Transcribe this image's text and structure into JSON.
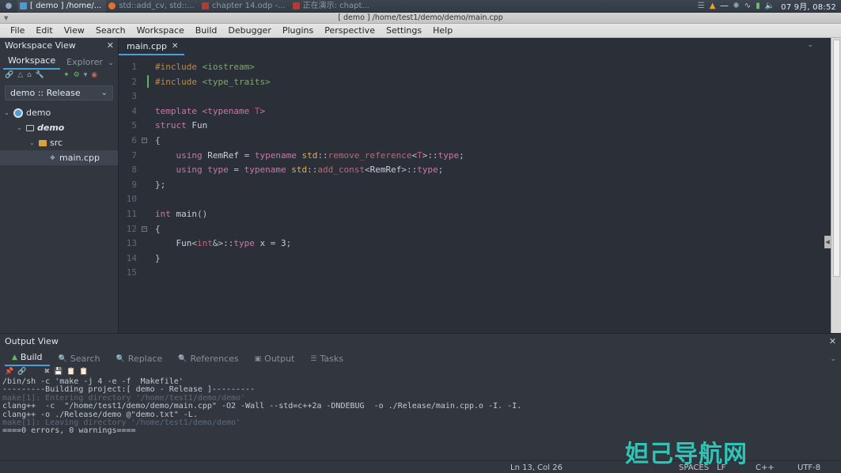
{
  "taskbar": {
    "start_icon": "menu-icon",
    "tasks": [
      {
        "label": "[ demo ] /home/...",
        "icon": "terminal-icon",
        "active": true
      },
      {
        "label": "std::add_cv, std::...",
        "icon": "firefox-icon",
        "active": false
      },
      {
        "label": "chapter 14.odp -...",
        "icon": "impress-icon",
        "active": false
      },
      {
        "label": "正在演示: chapt...",
        "icon": "impress-icon",
        "active": false
      }
    ],
    "tray_icons": [
      "network-icon",
      "warning-icon",
      "keyboard-icon",
      "bluetooth-icon",
      "wifi-icon",
      "battery-icon",
      "volume-icon"
    ],
    "clock": "07 9月, 08:52"
  },
  "titlebar": {
    "title": "[ demo ] /home/test1/demo/demo/main.cpp"
  },
  "menubar": {
    "items": [
      "File",
      "Edit",
      "View",
      "Search",
      "Workspace",
      "Build",
      "Debugger",
      "Plugins",
      "Perspective",
      "Settings",
      "Help"
    ]
  },
  "workspace_view": {
    "title": "Workspace View",
    "close_label": "✕",
    "tabs": [
      {
        "label": "Workspace",
        "active": true
      },
      {
        "label": "Explorer",
        "active": false
      }
    ],
    "overflow_chevron": "⌄",
    "toolbar_icons": [
      "link-icon",
      "send-icon",
      "home-icon",
      "wrench-icon",
      "run-icon",
      "build-icon",
      "chevron-down-icon",
      "stop-icon"
    ],
    "target_combo": {
      "value": "demo :: Release",
      "chevron": "⌄"
    },
    "tree": [
      {
        "label": "demo",
        "depth": 0,
        "icon": "project-icon",
        "twisty": "⌄",
        "selected": false,
        "emphasis": false
      },
      {
        "label": "demo",
        "depth": 1,
        "icon": "folder-icon",
        "twisty": "⌄",
        "selected": false,
        "emphasis": true
      },
      {
        "label": "src",
        "depth": 2,
        "icon": "folder-yellow-icon",
        "twisty": "⌄",
        "selected": false,
        "emphasis": false
      },
      {
        "label": "main.cpp",
        "depth": 3,
        "icon": "cpp-file-icon",
        "twisty": "",
        "selected": true,
        "emphasis": false
      }
    ]
  },
  "editor": {
    "tab": {
      "label": "main.cpp",
      "close": "✕"
    },
    "overflow_chevron": "⌄",
    "line_numbers": [
      "1",
      "2",
      "3",
      "4",
      "5",
      "6",
      "7",
      "8",
      "9",
      "10",
      "11",
      "12",
      "13",
      "14",
      "15"
    ],
    "lines": [
      {
        "n": 1,
        "tokens": [
          {
            "t": "#include ",
            "c": "k-pre"
          },
          {
            "t": "<iostream>",
            "c": "k-hdr"
          }
        ]
      },
      {
        "n": 2,
        "tokens": [
          {
            "t": "#include ",
            "c": "k-pre"
          },
          {
            "t": "<type_traits>",
            "c": "k-hdr"
          }
        ]
      },
      {
        "n": 3,
        "tokens": []
      },
      {
        "n": 4,
        "tokens": [
          {
            "t": "template ",
            "c": "k-kw"
          },
          {
            "t": "<typename ",
            "c": "k-kw"
          },
          {
            "t": "T",
            "c": "k-tmpl"
          },
          {
            "t": ">",
            "c": "k-kw"
          }
        ]
      },
      {
        "n": 5,
        "tokens": [
          {
            "t": "struct ",
            "c": "k-kw"
          },
          {
            "t": "Fun",
            "c": "k-id"
          }
        ]
      },
      {
        "n": 6,
        "tokens": [
          {
            "t": "{",
            "c": "k-punc"
          }
        ]
      },
      {
        "n": 7,
        "tokens": [
          {
            "t": "    using ",
            "c": "k-kw"
          },
          {
            "t": "RemRef ",
            "c": "k-id"
          },
          {
            "t": "= ",
            "c": "k-punc"
          },
          {
            "t": "typename ",
            "c": "k-kw"
          },
          {
            "t": "std",
            "c": "k-ns"
          },
          {
            "t": "::",
            "c": "k-punc"
          },
          {
            "t": "remove_reference",
            "c": "k-fn"
          },
          {
            "t": "<",
            "c": "k-punc"
          },
          {
            "t": "T",
            "c": "k-tmpl"
          },
          {
            "t": ">::",
            "c": "k-punc"
          },
          {
            "t": "type",
            "c": "k-kw"
          },
          {
            "t": ";",
            "c": "k-punc"
          }
        ]
      },
      {
        "n": 8,
        "tokens": [
          {
            "t": "    using ",
            "c": "k-kw"
          },
          {
            "t": "type ",
            "c": "k-kw"
          },
          {
            "t": "= ",
            "c": "k-punc"
          },
          {
            "t": "typename ",
            "c": "k-kw"
          },
          {
            "t": "std",
            "c": "k-ns"
          },
          {
            "t": "::",
            "c": "k-punc"
          },
          {
            "t": "add_const",
            "c": "k-fn"
          },
          {
            "t": "<",
            "c": "k-punc"
          },
          {
            "t": "RemRef",
            "c": "k-id"
          },
          {
            "t": ">::",
            "c": "k-punc"
          },
          {
            "t": "type",
            "c": "k-kw"
          },
          {
            "t": ";",
            "c": "k-punc"
          }
        ]
      },
      {
        "n": 9,
        "tokens": [
          {
            "t": "};",
            "c": "k-punc"
          }
        ]
      },
      {
        "n": 10,
        "tokens": []
      },
      {
        "n": 11,
        "tokens": [
          {
            "t": "int ",
            "c": "k-kw"
          },
          {
            "t": "main",
            "c": "k-id"
          },
          {
            "t": "()",
            "c": "k-punc"
          }
        ]
      },
      {
        "n": 12,
        "tokens": [
          {
            "t": "{",
            "c": "k-punc"
          }
        ]
      },
      {
        "n": 13,
        "tokens": [
          {
            "t": "    Fun",
            "c": "k-id"
          },
          {
            "t": "<",
            "c": "k-punc"
          },
          {
            "t": "int",
            "c": "k-tmpl"
          },
          {
            "t": "&>::",
            "c": "k-punc"
          },
          {
            "t": "type",
            "c": "k-kw"
          },
          {
            "t": " x ",
            "c": "k-id"
          },
          {
            "t": "= ",
            "c": "k-punc"
          },
          {
            "t": "3",
            "c": "k-num"
          },
          {
            "t": ";",
            "c": "k-punc"
          }
        ]
      },
      {
        "n": 14,
        "tokens": [
          {
            "t": "}",
            "c": "k-punc"
          }
        ]
      },
      {
        "n": 15,
        "tokens": []
      }
    ],
    "fold_lines": [
      6,
      12
    ]
  },
  "output_view": {
    "title": "Output View",
    "close_label": "✕",
    "tabs": [
      {
        "label": "Build",
        "icon": "build-icon",
        "active": true
      },
      {
        "label": "Search",
        "icon": "search-icon",
        "active": false
      },
      {
        "label": "Replace",
        "icon": "replace-icon",
        "active": false
      },
      {
        "label": "References",
        "icon": "search-icon",
        "active": false
      },
      {
        "label": "Output",
        "icon": "output-icon",
        "active": false
      },
      {
        "label": "Tasks",
        "icon": "tasks-icon",
        "active": false
      }
    ],
    "overflow_chevron": "⌄",
    "toolbar_icons": [
      "pin-icon",
      "link-icon",
      "clear-icon",
      "save-icon",
      "copy-icon",
      "copy-all-icon"
    ],
    "log": [
      {
        "text": "/bin/sh -c 'make -j 4 -e -f  Makefile'",
        "dim": false
      },
      {
        "text": "---------Building project:[ demo - Release ]---------",
        "dim": false
      },
      {
        "text": "make[1]: Entering directory '/home/test1/demo/demo'",
        "dim": true
      },
      {
        "text": "clang++  -c  \"/home/test1/demo/demo/main.cpp\" -O2 -Wall --std=c++2a -DNDEBUG  -o ./Release/main.cpp.o -I. -I.",
        "dim": false
      },
      {
        "text": "clang++ -o ./Release/demo @\"demo.txt\" -L.",
        "dim": false
      },
      {
        "text": "make[1]: Leaving directory '/home/test1/demo/demo'",
        "dim": true
      },
      {
        "text": "====0 errors, 0 warnings====",
        "dim": false
      }
    ]
  },
  "statusbar": {
    "position": "Ln 13, Col 26",
    "indent": "SPACES",
    "eol": "LF",
    "language": "C++",
    "encoding": "UTF-8"
  },
  "watermark": {
    "text": "妲己导航网"
  },
  "colors": {
    "accent": "#4a9fd8",
    "panel_bg": "#31363f",
    "editor_bg": "#2b3038",
    "green": "#67b96a",
    "watermark": "#2ec4b6"
  }
}
